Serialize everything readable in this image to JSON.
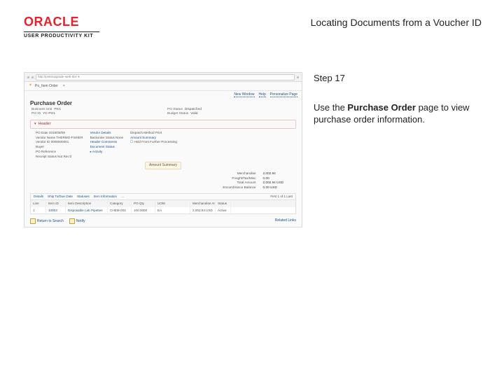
{
  "header": {
    "logo_word": "ORACLE",
    "logo_sub": "USER PRODUCTIVITY KIT",
    "doc_title": "Locating Documents from a Voucher ID"
  },
  "instruction": {
    "step_label": "Step 17",
    "pre_text": "Use the ",
    "bold_text": "Purchase Order",
    "post_text": " page to view purchase order information."
  },
  "screenshot": {
    "url_bar": "http://ps92upgrade-web-dev ▾",
    "tab_label": "Po_Item Order",
    "crumbs": [
      "New Window",
      "Help",
      "Personalize Page"
    ],
    "page_title": "Purchase Order",
    "top_kv": [
      {
        "k": "Business Unit",
        "v": "PKC"
      },
      {
        "k": "PO Status",
        "v": "Dispatched"
      },
      {
        "k": "PO ID",
        "v": "YC-PO1"
      },
      {
        "k": "Budget Status",
        "v": "Valid"
      }
    ],
    "header_label": "Header",
    "dense": {
      "col1": [
        "PO Date  2018/08/09",
        "Vendor Name  THERMO-FISHER",
        "Vendor ID  0000000001",
        "Buyer  ",
        "PO Reference  ",
        "Receipt Status  Not Rec'd"
      ],
      "col2": [
        "Vendor Details",
        "Backorder Status  None",
        "Header Comments",
        "Document Status",
        "▸ Activity"
      ],
      "col3": [
        "Dispatch Method  Print",
        "Amount Summary",
        "☐ Hold From Further Processing"
      ]
    },
    "amount_bar": "Amount Summary",
    "amounts": [
      {
        "lab": "Merchandise",
        "val": "2,002.94"
      },
      {
        "lab": "Freight/Tax/Misc",
        "val": "0.00"
      },
      {
        "lab": "Total Amount",
        "val": "2,002.94  USD"
      },
      {
        "lab": "Encumbrance Balance",
        "val": "0.00  USD"
      }
    ],
    "table": {
      "tabs": [
        "Details",
        "Ship To/Due Date",
        "Statuses",
        "Item Information",
        "…"
      ],
      "pager": "First  1 of 1  Last",
      "head": [
        "Line",
        "Item ID",
        "Item Description",
        "Category",
        "PO Qty",
        "UOM",
        "Merchandise Amount",
        "Status"
      ],
      "row": [
        "1",
        "10003",
        "Disposable Lab Pipettes",
        "CHEM-003",
        "100.0000",
        "EA",
        "2,002.94 USD",
        "Active"
      ]
    },
    "footer_left": [
      "Return to Search",
      "Notify"
    ],
    "footer_right": "Related Links"
  }
}
